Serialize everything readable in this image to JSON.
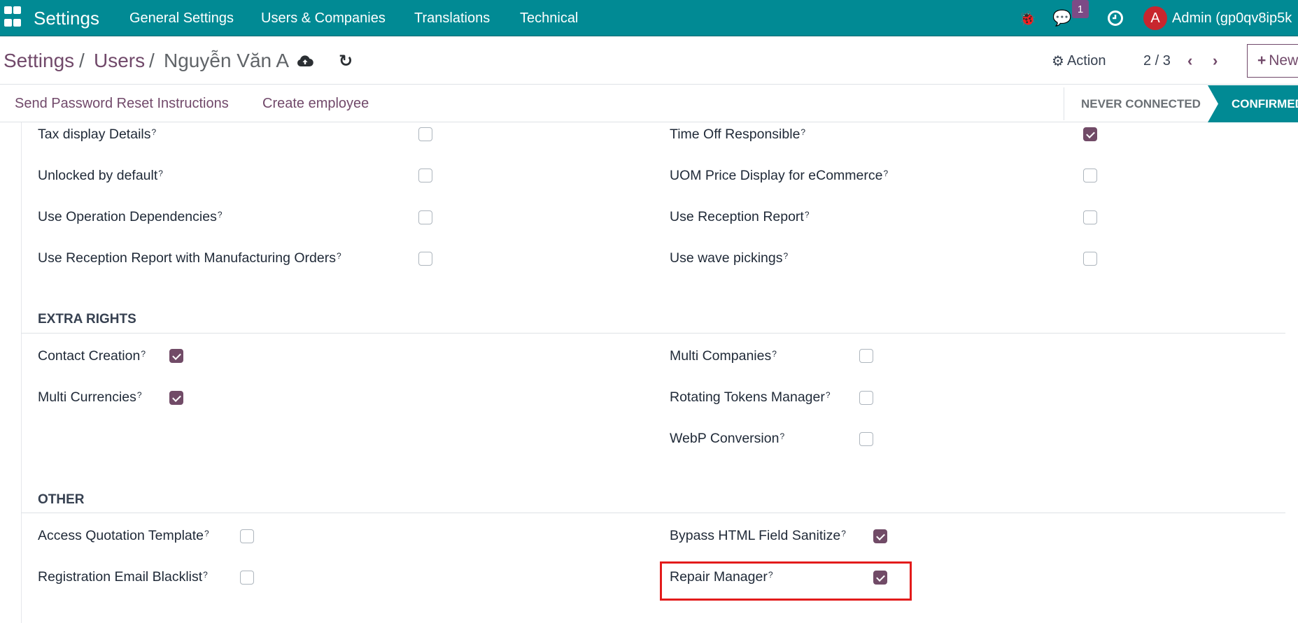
{
  "topbar": {
    "app": "Settings",
    "nav": [
      "General Settings",
      "Users & Companies",
      "Translations",
      "Technical"
    ],
    "messages_count": "1",
    "user_avatar": "A",
    "user": "Admin (gp0qv8ip5k",
    "color": "#018a94"
  },
  "breadcrumb": {
    "items": [
      "Settings",
      "Users",
      "Nguyễn Văn A"
    ],
    "sep": "/"
  },
  "control": {
    "action": "Action",
    "pager": "2 / 3",
    "new": "New"
  },
  "actions": {
    "send_reset": "Send Password Reset Instructions",
    "create_employee": "Create employee"
  },
  "status": {
    "stages": [
      "NEVER CONNECTED",
      "CONFIRMED"
    ],
    "current": "CONFIRMED"
  },
  "technical": {
    "left": [
      {
        "label": "Tax display Details",
        "checked": false
      },
      {
        "label": "Unlocked by default",
        "checked": false
      },
      {
        "label": "Use Operation Dependencies",
        "checked": false
      },
      {
        "label": "Use Reception Report with Manufacturing Orders",
        "checked": false
      }
    ],
    "right": [
      {
        "label": "Time Off Responsible",
        "checked": true
      },
      {
        "label": "UOM Price Display for eCommerce",
        "checked": false
      },
      {
        "label": "Use Reception Report",
        "checked": false
      },
      {
        "label": "Use wave pickings",
        "checked": false
      }
    ]
  },
  "extra_rights": {
    "title": "EXTRA RIGHTS",
    "left": [
      {
        "label": "Contact Creation",
        "checked": true
      },
      {
        "label": "Multi Currencies",
        "checked": true
      }
    ],
    "right": [
      {
        "label": "Multi Companies",
        "checked": false
      },
      {
        "label": "Rotating Tokens Manager",
        "checked": false
      },
      {
        "label": "WebP Conversion",
        "checked": false
      }
    ]
  },
  "other": {
    "title": "OTHER",
    "left": [
      {
        "label": "Access Quotation Template",
        "checked": false
      },
      {
        "label": "Registration Email Blacklist",
        "checked": false
      }
    ],
    "right": [
      {
        "label": "Bypass HTML Field Sanitize",
        "checked": true
      },
      {
        "label": "Repair Manager",
        "checked": true
      }
    ]
  },
  "help_mark": "?",
  "accent": "#714b67",
  "highlight_color": "#e31b1b"
}
